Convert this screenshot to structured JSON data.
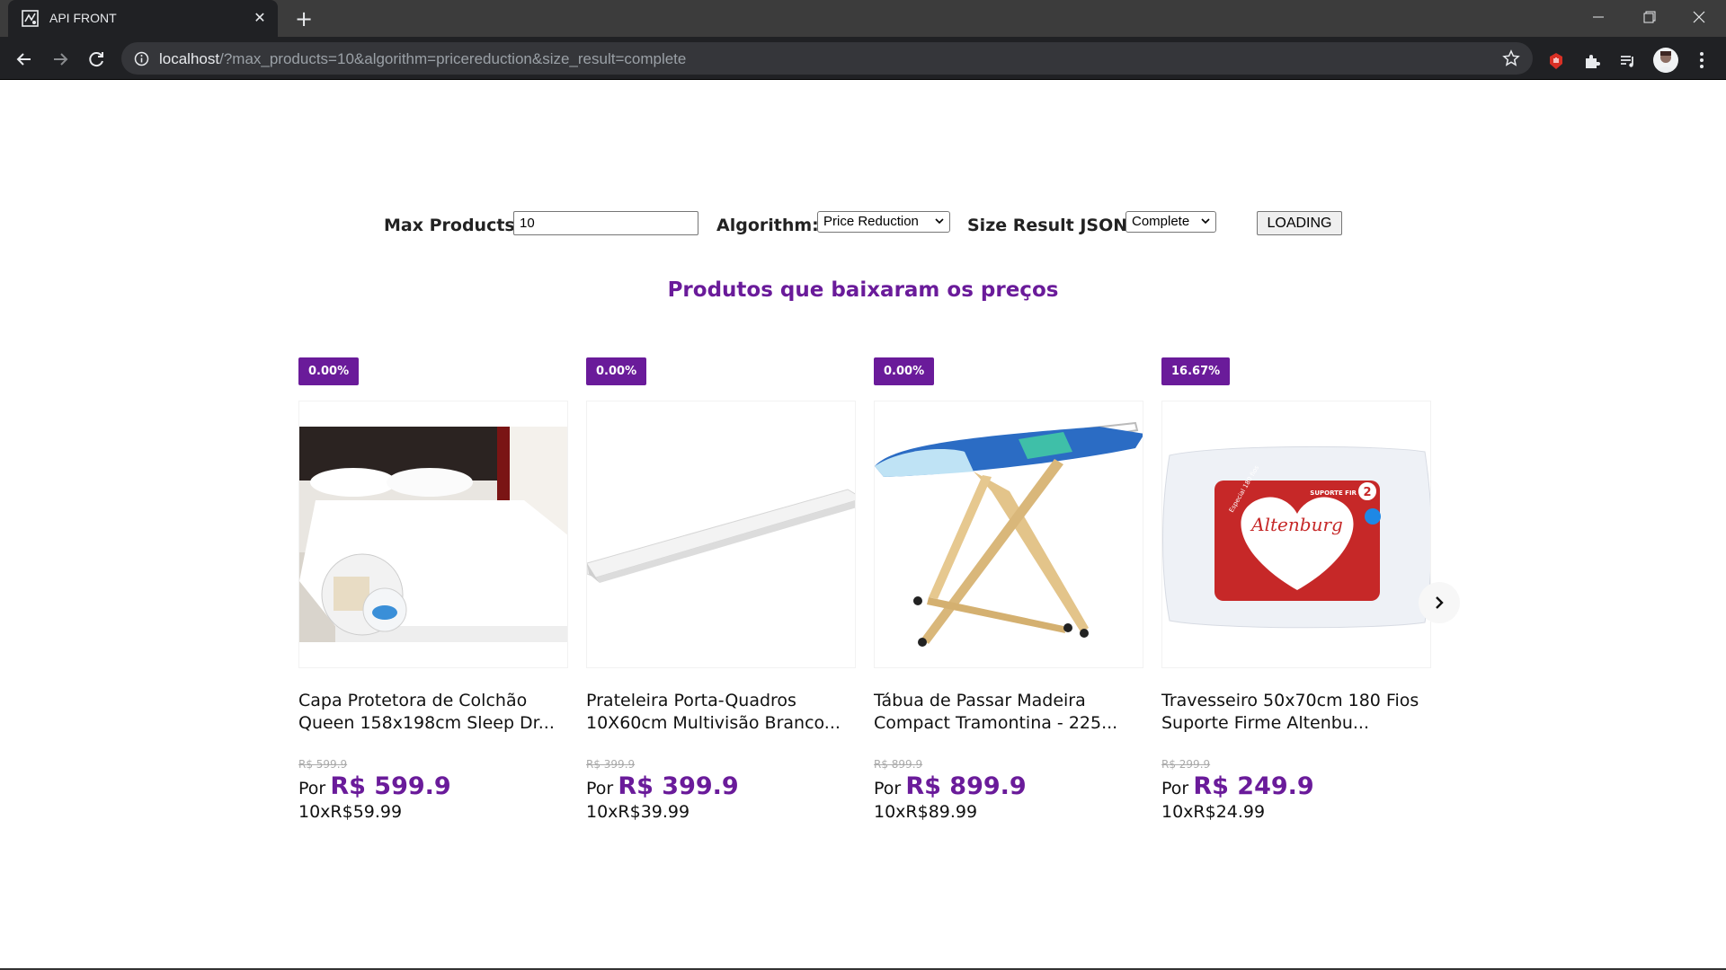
{
  "browser": {
    "tab_title": "API FRONT",
    "url_host": "localhost",
    "url_path": "/?max_products=10&algorithm=pricereduction&size_result=complete"
  },
  "form": {
    "max_products_label": "Max Products:",
    "max_products_value": "10",
    "algorithm_label": "Algorithm:",
    "algorithm_value": "Price Reduction",
    "size_label": "Size Result JSON:",
    "size_value": "Complete",
    "loading_button": "LOADING"
  },
  "section_title": "Produtos que baixaram os preços",
  "products": [
    {
      "badge": "0.00%",
      "name_line1": "Capa Protetora de Colchão",
      "name_line2": "Queen 158x198cm Sleep Dr...",
      "old_price": "R$ 599.9",
      "por": "Por",
      "price": "R$ 599.9",
      "installment": "10xR$59.99",
      "image": "mattress-protector-image"
    },
    {
      "badge": "0.00%",
      "name_line1": "Prateleira Porta-Quadros",
      "name_line2": "10X60cm Multivisão Branco...",
      "old_price": "R$ 399.9",
      "por": "Por",
      "price": "R$ 399.9",
      "installment": "10xR$39.99",
      "image": "white-shelf-image"
    },
    {
      "badge": "0.00%",
      "name_line1": "Tábua de Passar Madeira",
      "name_line2": "Compact Tramontina - 225...",
      "old_price": "R$ 899.9",
      "por": "Por",
      "price": "R$ 899.9",
      "installment": "10xR$89.99",
      "image": "ironing-board-image"
    },
    {
      "badge": "16.67%",
      "name_line1": "Travesseiro 50x70cm 180 Fios",
      "name_line2": "Suporte Firme Altenbu...",
      "old_price": "R$ 299.9",
      "por": "Por",
      "price": "R$ 249.9",
      "installment": "10xR$24.99",
      "image": "pillow-image",
      "pillow_label_brand": "Altenburg",
      "pillow_label_top": "SUPORTE FIRME",
      "pillow_label_side": "Especial 180 fios",
      "pillow_label_number": "2"
    }
  ],
  "colors": {
    "accent": "#6a1b9a",
    "chrome_dark": "#202124",
    "titlebar": "#3c3c3c"
  }
}
